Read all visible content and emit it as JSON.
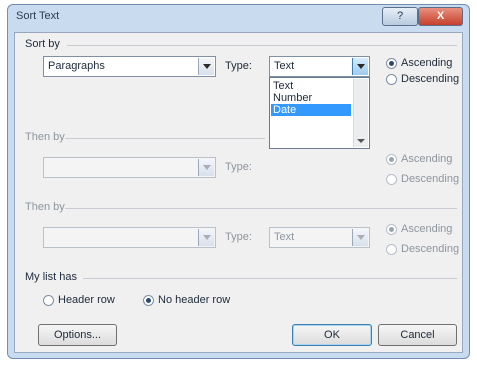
{
  "window": {
    "title": "Sort Text",
    "help_label": "?",
    "close_label": "X"
  },
  "sort_by": {
    "section_label": "Sort by",
    "field_value": "Paragraphs",
    "type_label": "Type:",
    "type_value": "Text",
    "dropdown_options": [
      "Text",
      "Number",
      "Date"
    ],
    "dropdown_selected": "Date",
    "ascending_label": "Ascending",
    "descending_label": "Descending",
    "order": "ascending"
  },
  "then_by_1": {
    "section_label": "Then by",
    "field_value": "",
    "type_label": "Type:",
    "ascending_label": "Ascending",
    "descending_label": "Descending",
    "enabled": false
  },
  "then_by_2": {
    "section_label": "Then by",
    "field_value": "",
    "type_label": "Type:",
    "type_value": "Text",
    "ascending_label": "Ascending",
    "descending_label": "Descending",
    "enabled": false
  },
  "my_list_has": {
    "section_label": "My list has",
    "header_row_label": "Header row",
    "no_header_row_label": "No header row",
    "selected": "no_header_row"
  },
  "buttons": {
    "options_label": "Options...",
    "ok_label": "OK",
    "cancel_label": "Cancel"
  },
  "colors": {
    "dialog_frame": "#c9dbee",
    "dialog_body": "#f0f0f0",
    "selection": "#3399ff",
    "close_button": "#c6402c"
  }
}
